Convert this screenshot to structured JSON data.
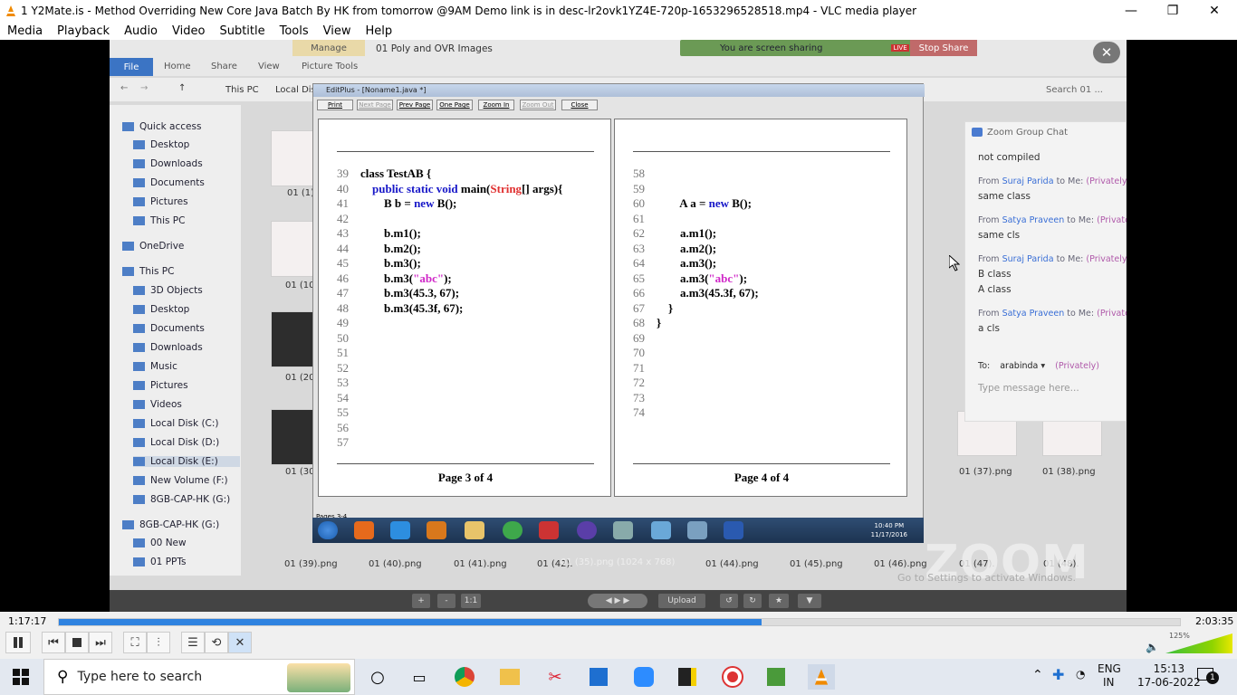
{
  "window": {
    "title": "1 Y2Mate.is - Method Overriding  New Core Java Batch By HK from tomorrow @9AM  Demo link is in desc-lr2ovk1YZ4E-720p-1653296528518.mp4 - VLC media player",
    "minimize": "—",
    "maximize": "❐",
    "close": "✕"
  },
  "menu": [
    "Media",
    "Playback",
    "Audio",
    "Video",
    "Subtitle",
    "Tools",
    "View",
    "Help"
  ],
  "explorer": {
    "tabs": [
      "File",
      "Home",
      "Share",
      "View",
      "Picture Tools"
    ],
    "manage": "Manage",
    "folder_title": "01 Poly and OVR Images",
    "path": [
      "This PC",
      "Local Dis"
    ],
    "search_placeholder": "Search 01 ...",
    "nav": [
      "Quick access",
      "Desktop",
      "Downloads",
      "Documents",
      "Pictures",
      "This PC",
      "OneDrive",
      "This PC",
      "3D Objects",
      "Desktop",
      "Documents",
      "Downloads",
      "Music",
      "Pictures",
      "Videos",
      "Local Disk (C:)",
      "Local Disk (D:)",
      "Local Disk (E:)",
      "New Volume (F:)",
      "8GB-CAP-HK (G:)",
      "8GB-CAP-HK (G:)",
      "00 New",
      "01 PPTs"
    ],
    "left_thumbs": [
      "01 (1).",
      "01 (10)",
      "01 (20)",
      "01 (30)"
    ],
    "bottom_files": [
      "01 (39).png",
      "01 (40).png",
      "01 (41).png",
      "01 (42).",
      "01 (44).png",
      "01 (45).png",
      "01 (46).png",
      "01 (47).",
      "01 (48)."
    ],
    "right_files": [
      "01 (37).png",
      "01 (38).png"
    ]
  },
  "share_bar": {
    "text": "You are screen sharing",
    "live": "LIVE",
    "stop": "Stop Share"
  },
  "editplus": {
    "title": "EditPlus - [Noname1.java *]",
    "tools": [
      "Print",
      "Next Page",
      "Prev Page",
      "One Page",
      "Zoom In",
      "Zoom Out",
      "Close"
    ],
    "status": "Pages 3-4",
    "left_page": {
      "lines": [
        {
          "n": "39",
          "code": "class TestAB {"
        },
        {
          "n": "40",
          "code": "    public static void main(String[] args){"
        },
        {
          "n": "41",
          "code": "        B b = new B();"
        },
        {
          "n": "42",
          "code": ""
        },
        {
          "n": "43",
          "code": "        b.m1();"
        },
        {
          "n": "44",
          "code": "        b.m2();"
        },
        {
          "n": "45",
          "code": "        b.m3();"
        },
        {
          "n": "46",
          "code": "        b.m3(\"abc\");"
        },
        {
          "n": "47",
          "code": "        b.m3(45.3, 67);"
        },
        {
          "n": "48",
          "code": "        b.m3(45.3f, 67);"
        },
        {
          "n": "49",
          "code": ""
        },
        {
          "n": "50",
          "code": ""
        },
        {
          "n": "51",
          "code": ""
        },
        {
          "n": "52",
          "code": ""
        },
        {
          "n": "53",
          "code": ""
        },
        {
          "n": "54",
          "code": ""
        },
        {
          "n": "55",
          "code": ""
        },
        {
          "n": "56",
          "code": ""
        },
        {
          "n": "57",
          "code": ""
        }
      ],
      "footer": "Page 3 of 4"
    },
    "right_page": {
      "lines": [
        {
          "n": "58",
          "code": ""
        },
        {
          "n": "59",
          "code": ""
        },
        {
          "n": "60",
          "code": "        A a = new B();"
        },
        {
          "n": "61",
          "code": ""
        },
        {
          "n": "62",
          "code": "        a.m1();"
        },
        {
          "n": "63",
          "code": "        a.m2();"
        },
        {
          "n": "64",
          "code": "        a.m3();"
        },
        {
          "n": "65",
          "code": "        a.m3(\"abc\");"
        },
        {
          "n": "66",
          "code": "        a.m3(45.3f, 67);"
        },
        {
          "n": "67",
          "code": "    }"
        },
        {
          "n": "68",
          "code": "}"
        },
        {
          "n": "69",
          "code": ""
        },
        {
          "n": "70",
          "code": ""
        },
        {
          "n": "71",
          "code": ""
        },
        {
          "n": "72",
          "code": ""
        },
        {
          "n": "73",
          "code": ""
        },
        {
          "n": "74",
          "code": ""
        }
      ],
      "footer": "Page 4 of 4"
    }
  },
  "win7_taskbar": {
    "time": "10:40 PM",
    "date": "11/17/2016"
  },
  "zoom_chat": {
    "header": "Zoom Group Chat",
    "messages": [
      {
        "from": "",
        "text": "not compiled"
      },
      {
        "from": "Suraj Parida",
        "text": "same class"
      },
      {
        "from": "Satya Praveen",
        "text": "same cls"
      },
      {
        "from": "Suraj Parida",
        "text": "B class"
      },
      {
        "from": "",
        "text": "A class"
      },
      {
        "from": "Satya Praveen",
        "text": "a cls"
      }
    ],
    "from_prefix": "From",
    "to_me": "to Me:",
    "privately": "(Privately)",
    "privately_short": "(Private",
    "to_label": "To:",
    "to_value": "arabinda",
    "placeholder": "Type message here..."
  },
  "zoom_watermark": "ZOOM",
  "activate": "Go to Settings to activate Windows.",
  "image_caption": "01 (35).png (1024 x 768)",
  "viewer": {
    "one_to_one": "1:1",
    "upload": "Upload"
  },
  "player": {
    "elapsed": "1:17:17",
    "total": "2:03:35",
    "progress": 0.627,
    "volume": "125%"
  },
  "taskbar": {
    "search": "Type here to search",
    "lang1": "ENG",
    "lang2": "IN",
    "time": "15:13",
    "date": "17-06-2022",
    "notif": "1"
  }
}
